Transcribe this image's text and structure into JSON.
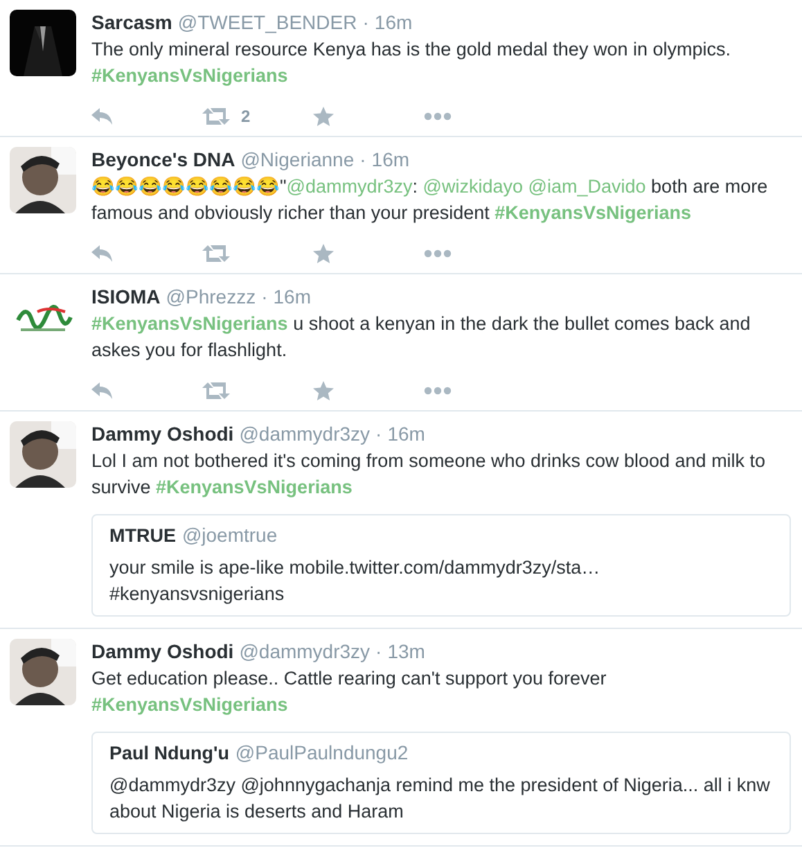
{
  "tweets": [
    {
      "name": "Sarcasm",
      "handle": "@TWEET_BENDER",
      "dot": "·",
      "time": "16m",
      "avatar": {
        "kind": "suit"
      },
      "body": [
        {
          "kind": "text",
          "text": "The only mineral resource Kenya has is the gold medal they won in olympics. "
        },
        {
          "kind": "hashtag",
          "text": "#KenyansVsNigerians"
        }
      ],
      "actions": {
        "shown": true,
        "retweets": "2"
      }
    },
    {
      "name": "Beyonce's DNA",
      "handle": "@Nigerianne",
      "dot": "·",
      "time": "16m",
      "avatar": {
        "kind": "portrait"
      },
      "body": [
        {
          "kind": "text",
          "text": "😂😂😂😂😂😂😂😂\""
        },
        {
          "kind": "mention",
          "text": "@dammydr3zy"
        },
        {
          "kind": "text",
          "text": ": "
        },
        {
          "kind": "mention",
          "text": "@wizkidayo"
        },
        {
          "kind": "mention",
          "text": "@iam_Davido"
        },
        {
          "kind": "text",
          "text": " both are more famous and obviously richer than your president "
        },
        {
          "kind": "hashtag",
          "text": "#KenyansVsNigerians"
        }
      ],
      "actions": {
        "shown": true
      }
    },
    {
      "name": "ISIOMA",
      "handle": "@Phrezzz",
      "dot": "·",
      "time": "16m",
      "avatar": {
        "kind": "logo"
      },
      "body": [
        {
          "kind": "hashtag",
          "text": "#KenyansVsNigerians"
        },
        {
          "kind": "text",
          "text": " u shoot a kenyan in the dark the bullet comes back and askes you for flashlight."
        }
      ],
      "actions": {
        "shown": true
      }
    },
    {
      "name": "Dammy Oshodi",
      "handle": "@dammydr3zy",
      "dot": "·",
      "time": "16m",
      "avatar": {
        "kind": "portrait"
      },
      "body": [
        {
          "kind": "text",
          "text": "Lol I am not bothered it's coming from someone who drinks cow blood and milk to survive "
        },
        {
          "kind": "hashtag",
          "text": "#KenyansVsNigerians"
        }
      ],
      "quote": {
        "name": "MTRUE",
        "handle": "@joemtrue",
        "text": "your smile is ape-like mobile.twitter.com/dammydr3zy/sta… #kenyansvsnigerians"
      }
    },
    {
      "name": "Dammy Oshodi",
      "handle": "@dammydr3zy",
      "dot": "·",
      "time": "13m",
      "avatar": {
        "kind": "portrait"
      },
      "body": [
        {
          "kind": "text",
          "text": "Get education please.. Cattle rearing can't support you forever "
        },
        {
          "kind": "hashtag",
          "text": "#KenyansVsNigerians"
        }
      ],
      "quote": {
        "name": "Paul Ndung'u",
        "handle": "@PaulPaulndungu2",
        "text": "@dammydr3zy @johnnygachanja remind me the president of Nigeria... all i knw about Nigeria is deserts and Haram"
      }
    }
  ]
}
